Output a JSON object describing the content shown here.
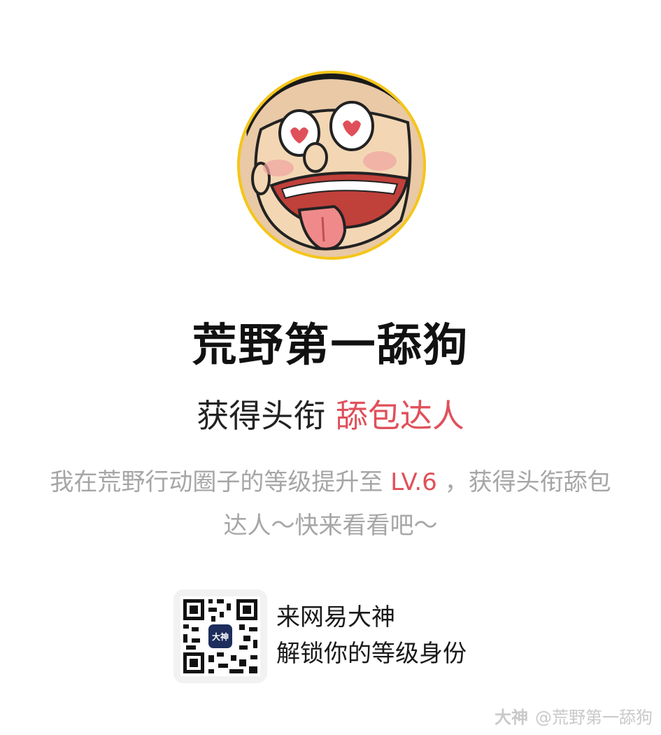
{
  "profile": {
    "nickname": "荒野第一舔狗",
    "title_prefix": "获得头衔",
    "title_name": "舔包达人"
  },
  "description": {
    "part1": "我在荒野行动圈子的等级提升至",
    "level": "LV.6",
    "part2": "，获得头衔舔包达人～快来看看吧～"
  },
  "promo": {
    "line1": "来网易大神",
    "line2": "解锁你的等级身份",
    "qr_badge": "大神"
  },
  "watermark": {
    "brand": "大神",
    "handle": "@荒野第一舔狗"
  },
  "colors": {
    "accent": "#e0505a",
    "avatar_ring": "#f5c518",
    "muted_text": "#a6a6a6"
  }
}
